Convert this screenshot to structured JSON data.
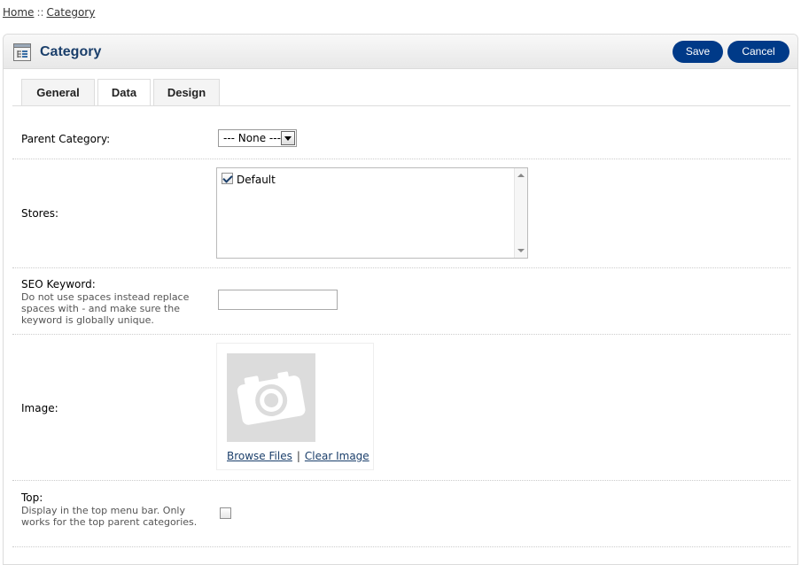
{
  "breadcrumb": {
    "home": "Home",
    "separator": "::",
    "current": "Category"
  },
  "heading": {
    "title": "Category",
    "icon": "category-list-icon",
    "save_label": "Save",
    "cancel_label": "Cancel"
  },
  "tabs": [
    {
      "label": "General",
      "active": false
    },
    {
      "label": "Data",
      "active": true
    },
    {
      "label": "Design",
      "active": false
    }
  ],
  "form": {
    "parent_category": {
      "label": "Parent Category:",
      "selected": "--- None ---"
    },
    "stores": {
      "label": "Stores:",
      "options": [
        {
          "label": "Default",
          "checked": true
        }
      ]
    },
    "seo_keyword": {
      "label": "SEO Keyword:",
      "help": "Do not use spaces instead replace spaces with - and make sure the keyword is globally unique.",
      "value": ""
    },
    "image": {
      "label": "Image:",
      "browse_label": "Browse Files",
      "separator": "|",
      "clear_label": "Clear Image",
      "placeholder_icon": "camera-icon"
    },
    "top": {
      "label": "Top:",
      "help": "Display in the top menu bar. Only works for the top parent categories.",
      "checked": false
    }
  },
  "colors": {
    "accent": "#003a88",
    "title": "#1b3f6b"
  }
}
